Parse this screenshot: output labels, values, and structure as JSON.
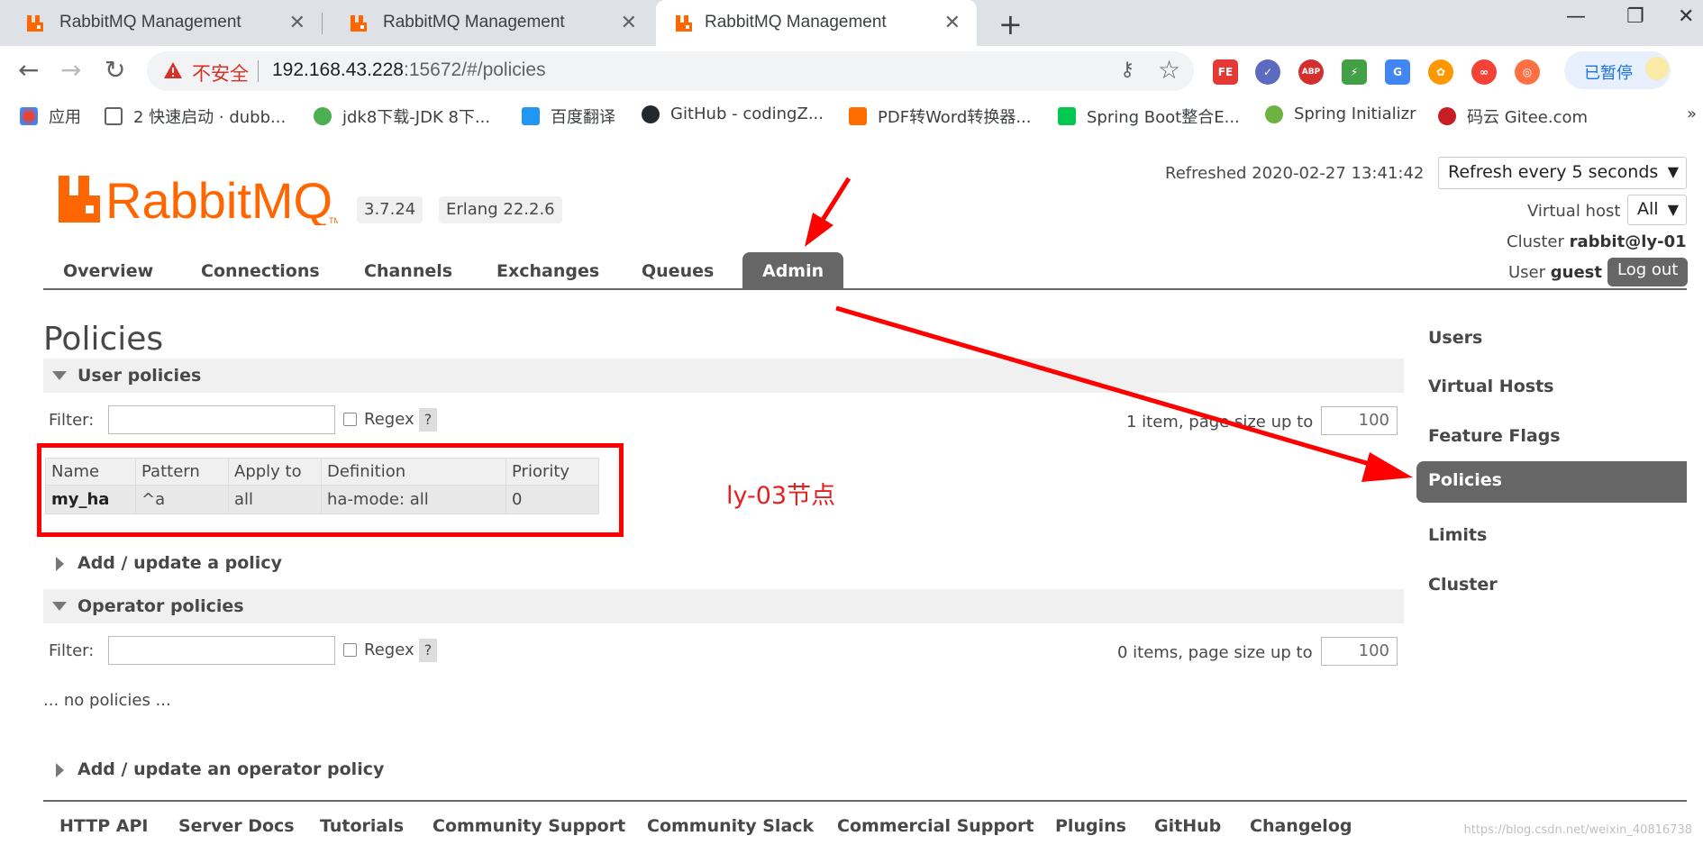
{
  "browser": {
    "tabs": [
      {
        "title": "RabbitMQ Management",
        "active": false
      },
      {
        "title": "RabbitMQ Management",
        "active": false
      },
      {
        "title": "RabbitMQ Management",
        "active": true
      }
    ],
    "close_glyph": "✕",
    "new_tab_glyph": "+",
    "window_controls": [
      "—",
      "❐",
      "✕"
    ],
    "insecure_label": "不安全",
    "url_host": "192.168.43.228",
    "url_rest": ":15672/#/policies",
    "extensions": [
      {
        "label": "FE",
        "color": "#e53935"
      },
      {
        "label": "✓",
        "color": "#5c6bc0"
      },
      {
        "label": "ABP",
        "color": "#d32f2f"
      },
      {
        "label": "⚡",
        "color": "#43a047"
      },
      {
        "label": "G",
        "color": "#4285f4"
      },
      {
        "label": "✿",
        "color": "#ff9800"
      },
      {
        "label": "∞",
        "color": "#f44336"
      },
      {
        "label": "◎",
        "color": "#ff7043"
      }
    ],
    "paused_label": "已暂停",
    "bookmarks": [
      {
        "label": "应用",
        "color": "#1a73e8"
      },
      {
        "label": "2 快速启动 · dubb...",
        "color": "#5f6368"
      },
      {
        "label": "jdk8下载-JDK 8下...",
        "color": "#4caf50"
      },
      {
        "label": "百度翻译",
        "color": "#2196f3"
      },
      {
        "label": "GitHub - codingZ...",
        "color": "#24292e"
      },
      {
        "label": "PDF转Word转换器...",
        "color": "#ff6d00"
      },
      {
        "label": "Spring Boot整合E...",
        "color": "#00c853"
      },
      {
        "label": "Spring Initializr",
        "color": "#6db33f"
      },
      {
        "label": "码云 Gitee.com",
        "color": "#c71d23"
      }
    ],
    "more_bookmarks": "»"
  },
  "rmq": {
    "version": "3.7.24",
    "erlang": "Erlang 22.2.6",
    "refreshed": "Refreshed 2020-02-27 13:41:42",
    "refresh_option": "Refresh every 5 seconds",
    "vhost_label": "Virtual host",
    "vhost_value": "All",
    "cluster_label": "Cluster",
    "cluster_value": "rabbit@ly-01",
    "user_label": "User",
    "user_value": "guest",
    "logout": "Log out",
    "nav": [
      "Overview",
      "Connections",
      "Channels",
      "Exchanges",
      "Queues",
      "Admin"
    ],
    "page_title": "Policies",
    "user_policies": {
      "heading": "User policies",
      "filter_label": "Filter:",
      "regex_label": "Regex",
      "help": "?",
      "paging": "1 item, page size up to",
      "page_size": "100",
      "columns": [
        "Name",
        "Pattern",
        "Apply to",
        "Definition",
        "Priority"
      ],
      "rows": [
        {
          "name": "my_ha",
          "pattern": "^a",
          "apply_to": "all",
          "definition": "ha-mode: all",
          "priority": "0"
        }
      ]
    },
    "add_policy": "Add / update a policy",
    "operator_policies": {
      "heading": "Operator policies",
      "filter_label": "Filter:",
      "regex_label": "Regex",
      "help": "?",
      "paging": "0 items, page size up to",
      "page_size": "100",
      "empty": "... no policies ..."
    },
    "add_operator_policy": "Add / update an operator policy",
    "sidebar": [
      "Users",
      "Virtual Hosts",
      "Feature Flags",
      "Policies",
      "Limits",
      "Cluster"
    ],
    "footer": [
      "HTTP API",
      "Server Docs",
      "Tutorials",
      "Community Support",
      "Community Slack",
      "Commercial Support",
      "Plugins",
      "GitHub",
      "Changelog"
    ],
    "annotation": "ly-03节点",
    "watermark": "https://blog.csdn.net/weixin_40816738"
  },
  "colors": {
    "rabbit_orange": "#ff6600",
    "annotation_red": "#ff0000",
    "active_tab_gray": "#666666"
  }
}
